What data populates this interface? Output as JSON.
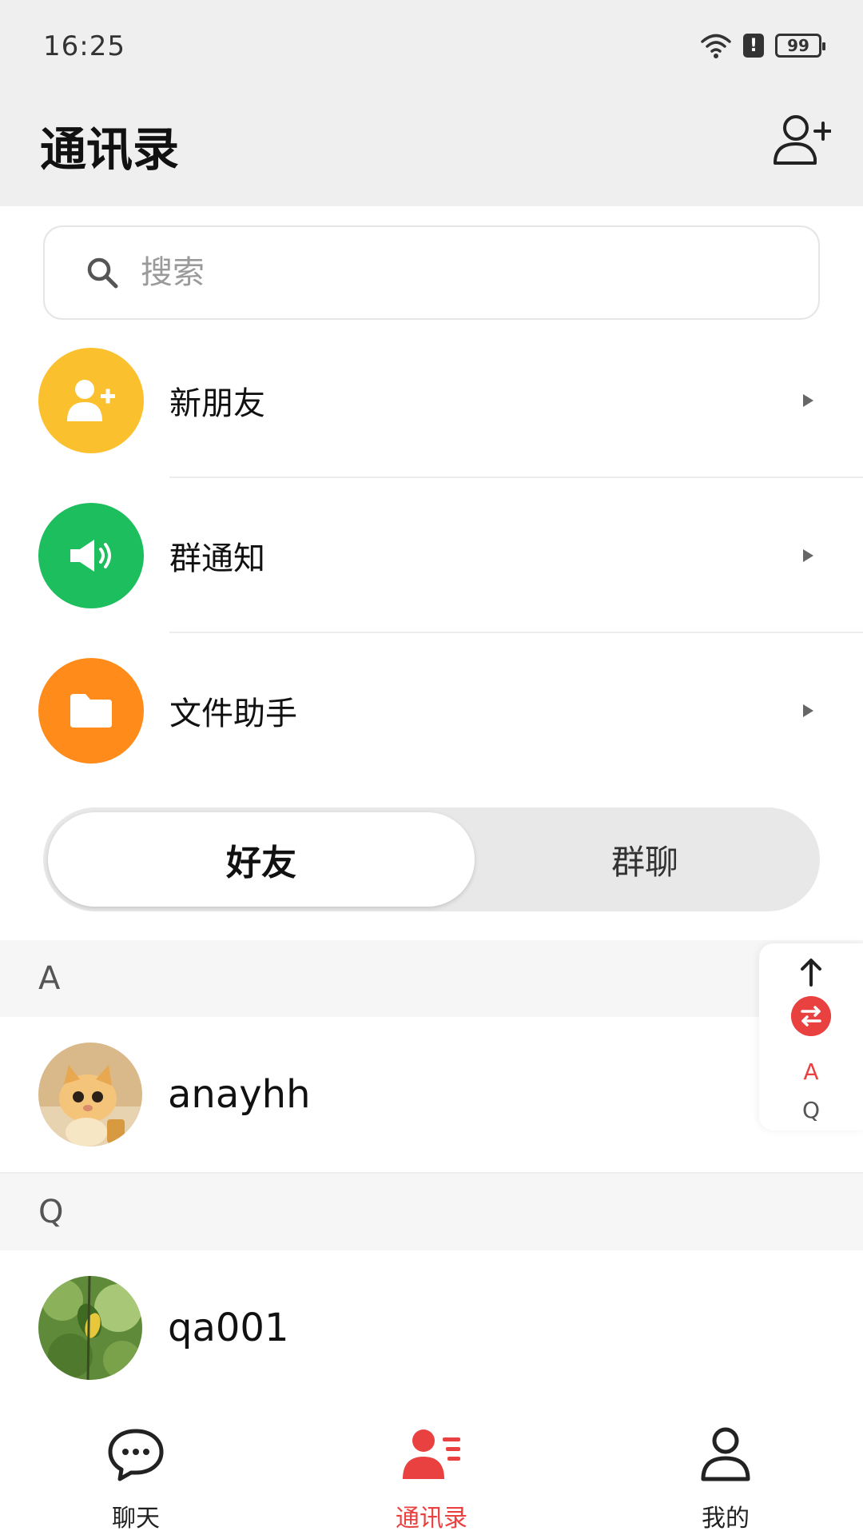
{
  "status_bar": {
    "time": "16:25",
    "battery": "99",
    "alert": "!"
  },
  "header": {
    "title": "通讯录",
    "add_icon": "add-contact-icon"
  },
  "search": {
    "placeholder": "搜索"
  },
  "features": [
    {
      "label": "新朋友",
      "icon": "add-friend-icon",
      "color": "#FBC02D"
    },
    {
      "label": "群通知",
      "icon": "megaphone-icon",
      "color": "#1DBE5E"
    },
    {
      "label": "文件助手",
      "icon": "folder-icon",
      "color": "#FF8C1A"
    }
  ],
  "tabs": {
    "friends": "好友",
    "groups": "群聊",
    "active": "好友"
  },
  "contacts": [
    {
      "section": "A",
      "name": "anayhh",
      "avatar": "cat-photo"
    },
    {
      "section": "Q",
      "name": "qa001",
      "avatar": "plant-photo"
    }
  ],
  "index_bar": {
    "letters": [
      "A",
      "Q"
    ],
    "active_letter": "A",
    "accent": "#E84140"
  },
  "bottom_nav": [
    {
      "label": "聊天",
      "icon": "chat-icon",
      "active": false
    },
    {
      "label": "通讯录",
      "icon": "contacts-icon",
      "active": true
    },
    {
      "label": "我的",
      "icon": "profile-icon",
      "active": false
    }
  ],
  "colors": {
    "accent": "#E84140",
    "header_bg": "#EFEFEF"
  }
}
